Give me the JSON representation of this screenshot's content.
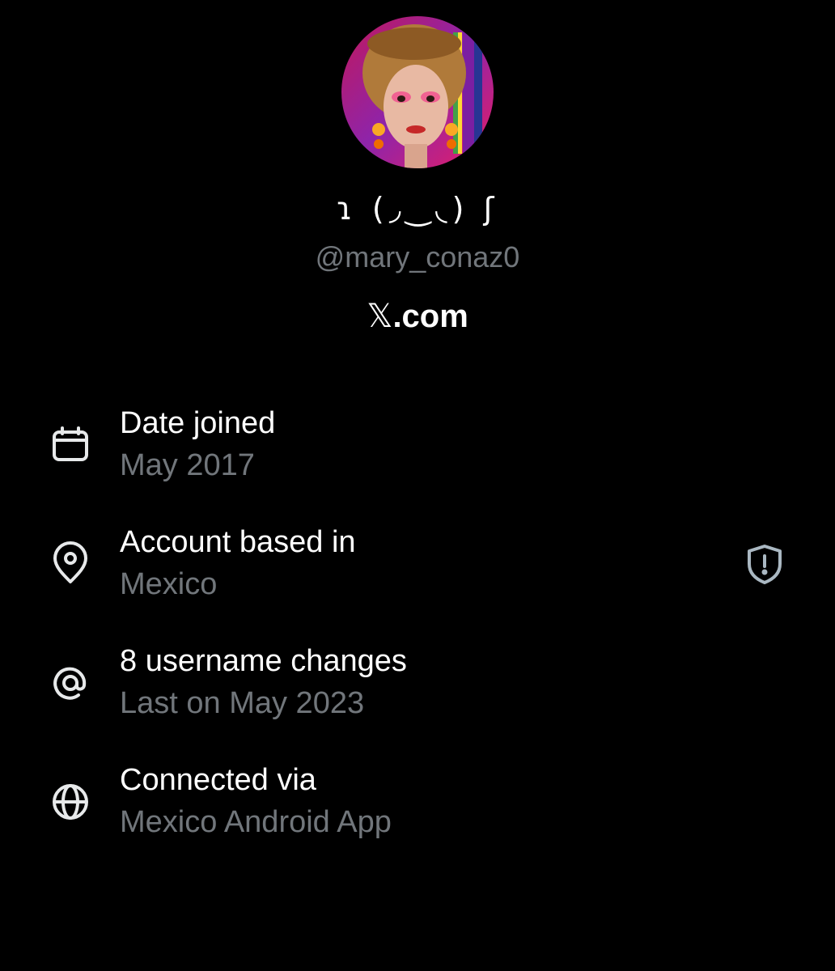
{
  "profile": {
    "display_name": "ɿ (◞‿◟) ʃ",
    "handle": "@mary_conaz0",
    "site_glyph": "𝕏",
    "site_suffix": ".com"
  },
  "info": [
    {
      "icon": "calendar-icon",
      "title": "Date joined",
      "value": "May 2017"
    },
    {
      "icon": "location-pin-icon",
      "title": "Account based in",
      "value": "Mexico"
    },
    {
      "icon": "at-sign-icon",
      "title": "8 username changes",
      "value": "Last on May 2023"
    },
    {
      "icon": "globe-icon",
      "title": "Connected via",
      "value": "Mexico Android App"
    }
  ],
  "colors": {
    "background": "#000000",
    "primary_text": "#ffffff",
    "secondary_text": "#71767b",
    "icon": "#e7e9ea"
  }
}
